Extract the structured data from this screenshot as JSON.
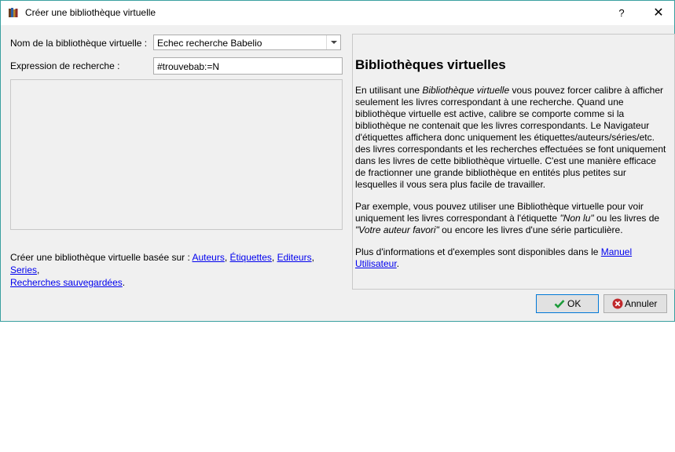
{
  "window": {
    "title": "Créer une bibliothèque virtuelle",
    "help_symbol": "?",
    "close_symbol": "✕"
  },
  "form": {
    "name_label": "Nom de la bibliothèque virtuelle :",
    "name_value": "Echec recherche Babelio",
    "expr_label": "Expression de recherche :",
    "expr_value": "#trouvebab:=N"
  },
  "based_on": {
    "prefix": "Créer une bibliothèque virtuelle basée sur : ",
    "links": [
      "Auteurs",
      "Étiquettes",
      "Editeurs",
      "Series",
      "Recherches sauvegardées"
    ],
    "sep": ", ",
    "end": "."
  },
  "help": {
    "title": "Bibliothèques virtuelles",
    "p1_a": "En utilisant une ",
    "p1_em": "Bibliothèque virtuelle",
    "p1_b": " vous pouvez forcer calibre à afficher seulement les livres correspondant à une recherche. Quand une bibliothèque virtuelle est active, calibre se comporte comme si la bibliothèque ne contenait que les livres correspondants. Le Navigateur d'étiquettes affichera donc uniquement les étiquettes/auteurs/séries/etc. des livres correspondants et les recherches effectuées se font uniquement dans les livres de cette bibliothèque virtuelle. C'est une manière efficace de fractionner une grande bibliothèque en entités plus petites sur lesquelles il vous sera plus facile de travailler.",
    "p2_a": "Par exemple, vous pouvez utiliser une Bibliothèque virtuelle pour voir uniquement les livres correspondant à l'étiquette ",
    "p2_em1": "\"Non lu\"",
    "p2_b": " ou les livres de ",
    "p2_em2": "\"Votre auteur favori\"",
    "p2_c": " ou encore les livres d'une série particulière.",
    "p3_a": "Plus d'informations et d'exemples sont disponibles dans le ",
    "p3_link": "Manuel Utilisateur",
    "p3_b": "."
  },
  "buttons": {
    "ok": "OK",
    "cancel": "Annuler"
  },
  "colors": {
    "ok_check": "#1c9b3a",
    "cancel_icon": "#c0282b",
    "link": "#0000ee"
  }
}
